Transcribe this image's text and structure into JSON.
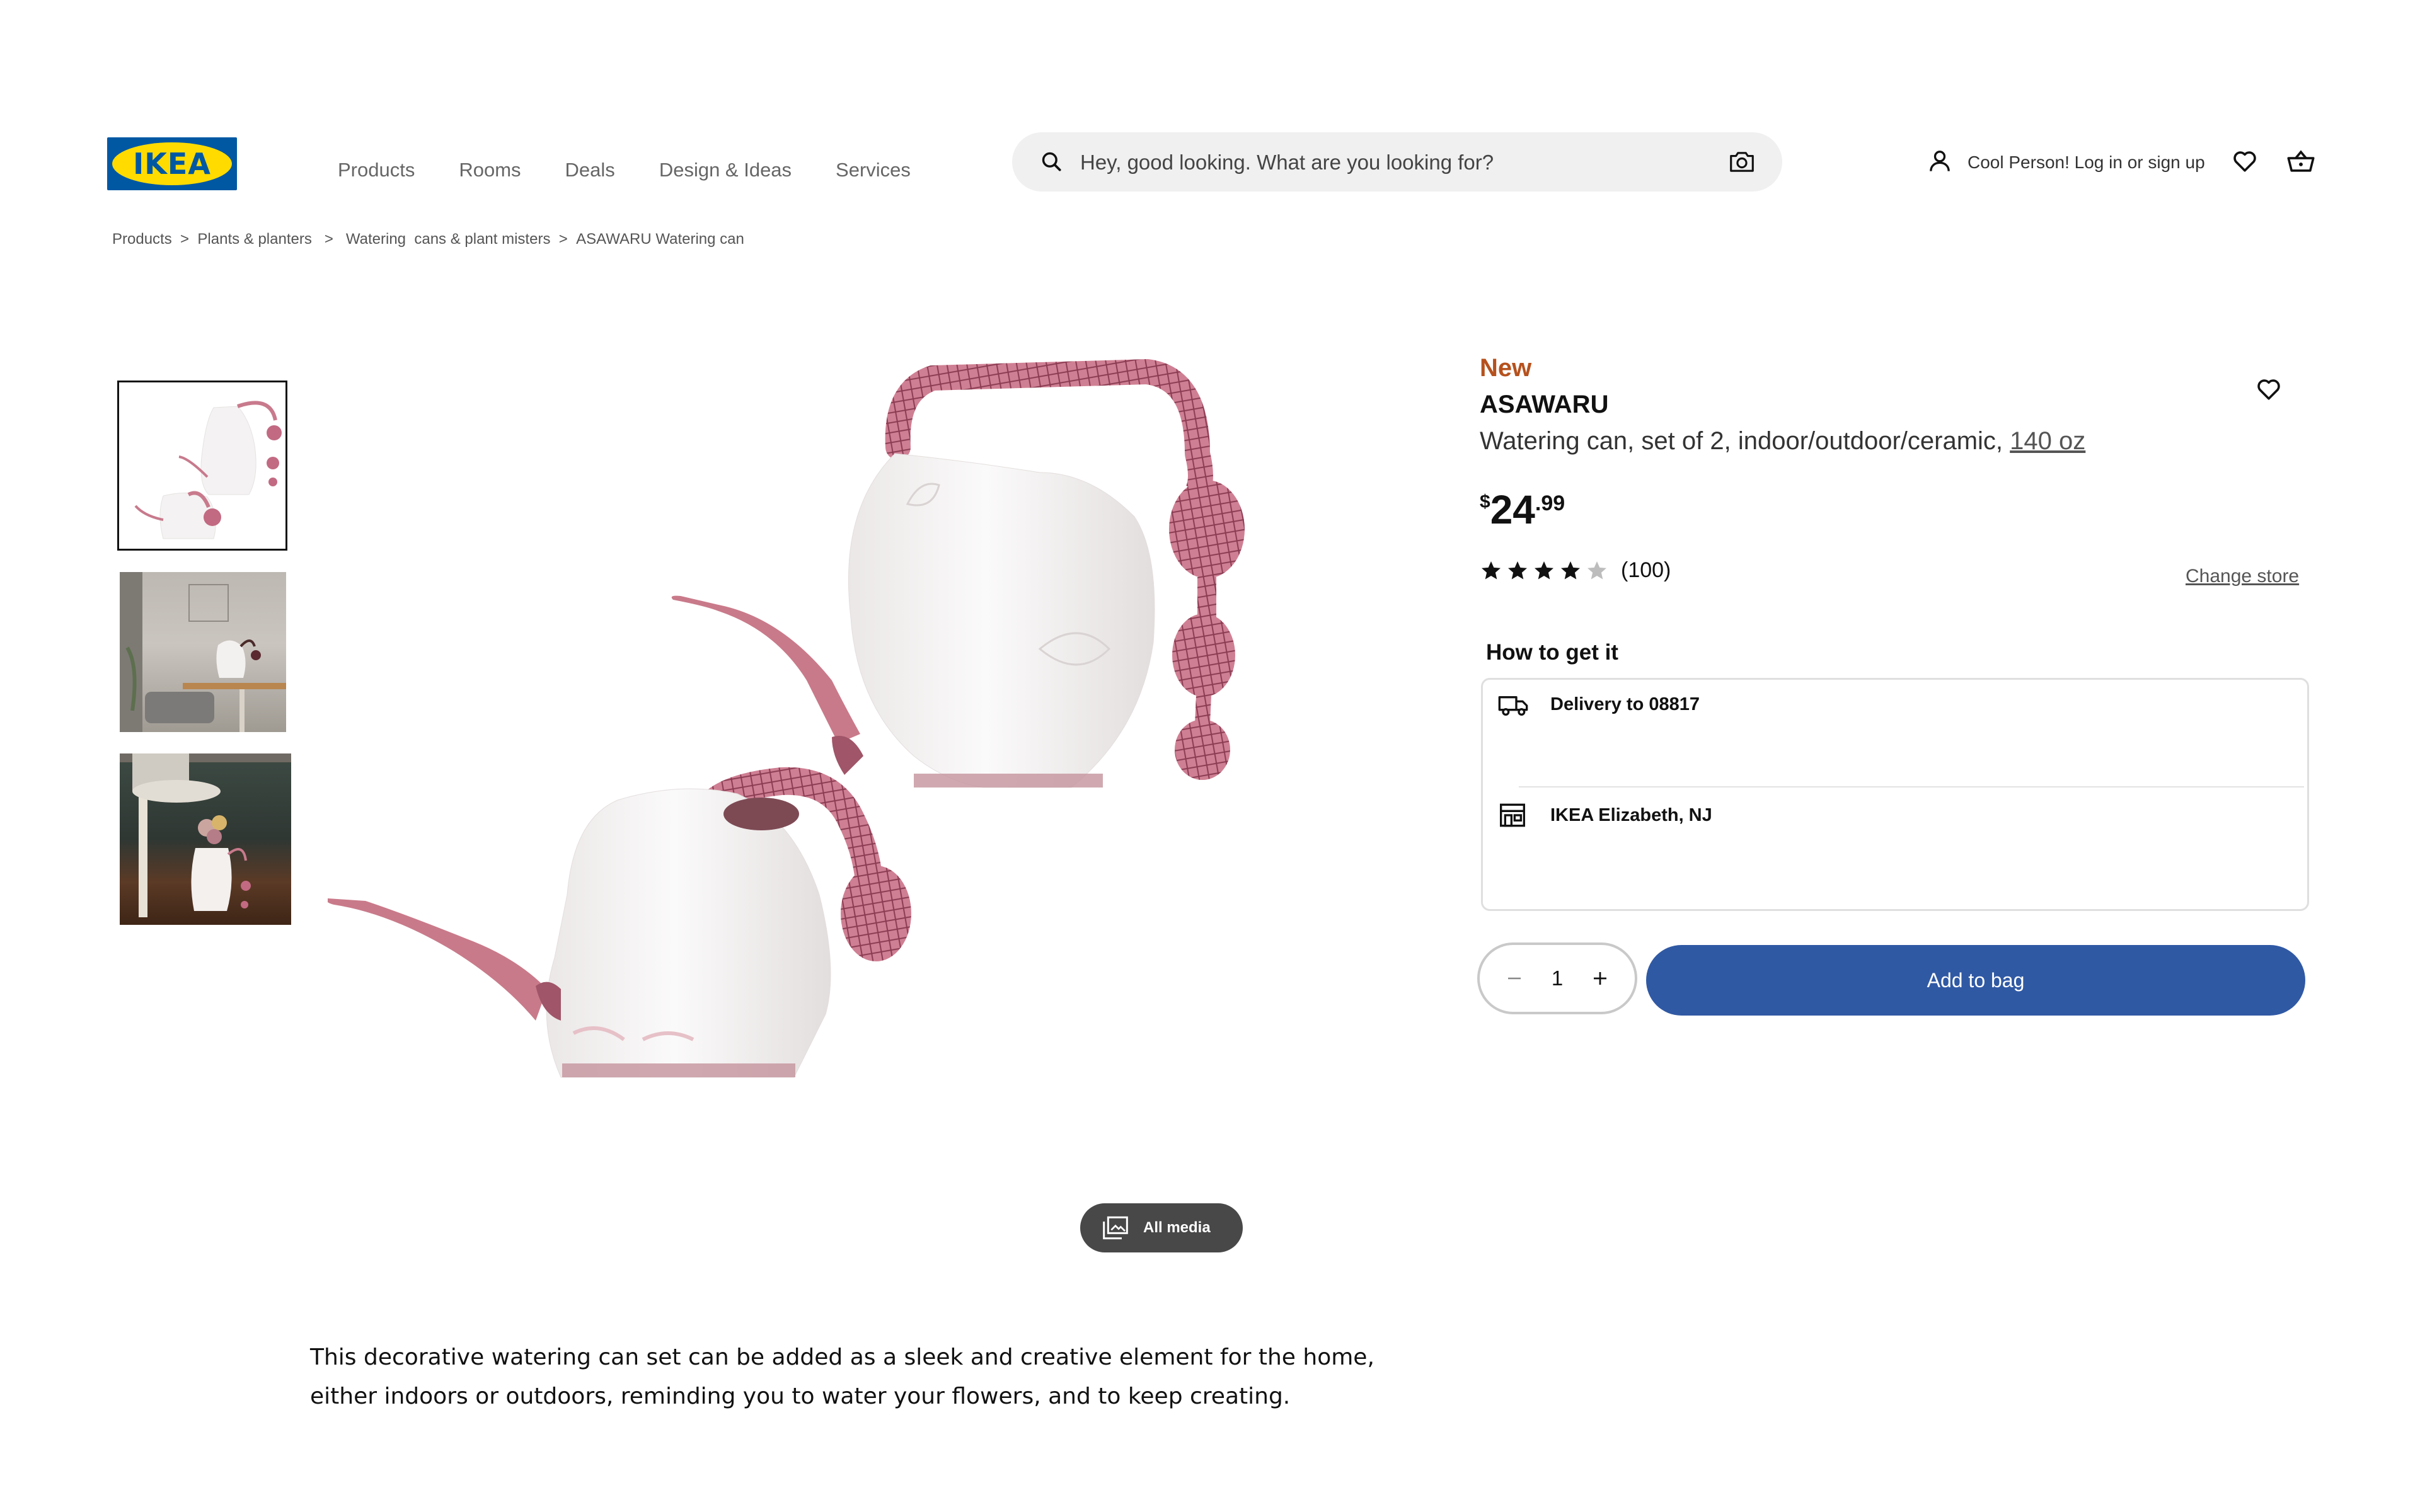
{
  "brand": {
    "logo_text": "IKEA",
    "colors": {
      "blue": "#0058a3",
      "yellow": "#ffdb00",
      "accent_blue": "#3059a4",
      "new_orange": "#b6511d"
    }
  },
  "nav": {
    "items": [
      "Products",
      "Rooms",
      "Deals",
      "Design & Ideas",
      "Services"
    ]
  },
  "search": {
    "placeholder": "Hey, good looking. What are you looking for?"
  },
  "account": {
    "login_label": "Cool Person! Log in or sign up"
  },
  "breadcrumb": {
    "items": [
      "Products",
      "Plants & planters",
      "Watering  cans & plant misters",
      "ASAWARU Watering can"
    ],
    "separator": ">"
  },
  "product": {
    "badge": "New",
    "name": "ASAWARU",
    "description": "Watering can, set of 2, indoor/outdoor/ceramic,",
    "size": "140 oz",
    "price": {
      "currency": "$",
      "integer": "24",
      "decimal": ".99"
    },
    "rating": {
      "value": 4,
      "max": 5,
      "reviews": "(100)"
    },
    "change_store_label": "Change store",
    "long_description": "This decorative watering can set can be added as a sleek and creative element for the home, either indoors or outdoors, reminding you to water your flowers, and to keep creating."
  },
  "media": {
    "all_media_label": "All media",
    "thumbnail_count": 3
  },
  "fulfillment": {
    "title": "How to get it",
    "delivery_label": "Delivery to 08817",
    "store_label": "IKEA Elizabeth, NJ"
  },
  "cart": {
    "quantity": "1",
    "add_label": "Add to bag"
  },
  "icons": [
    "search-icon",
    "camera-icon",
    "user-icon",
    "heart-icon",
    "shopping-basket-icon",
    "gallery-icon",
    "star-icon",
    "truck-icon",
    "store-icon",
    "minus-icon",
    "plus-icon"
  ]
}
